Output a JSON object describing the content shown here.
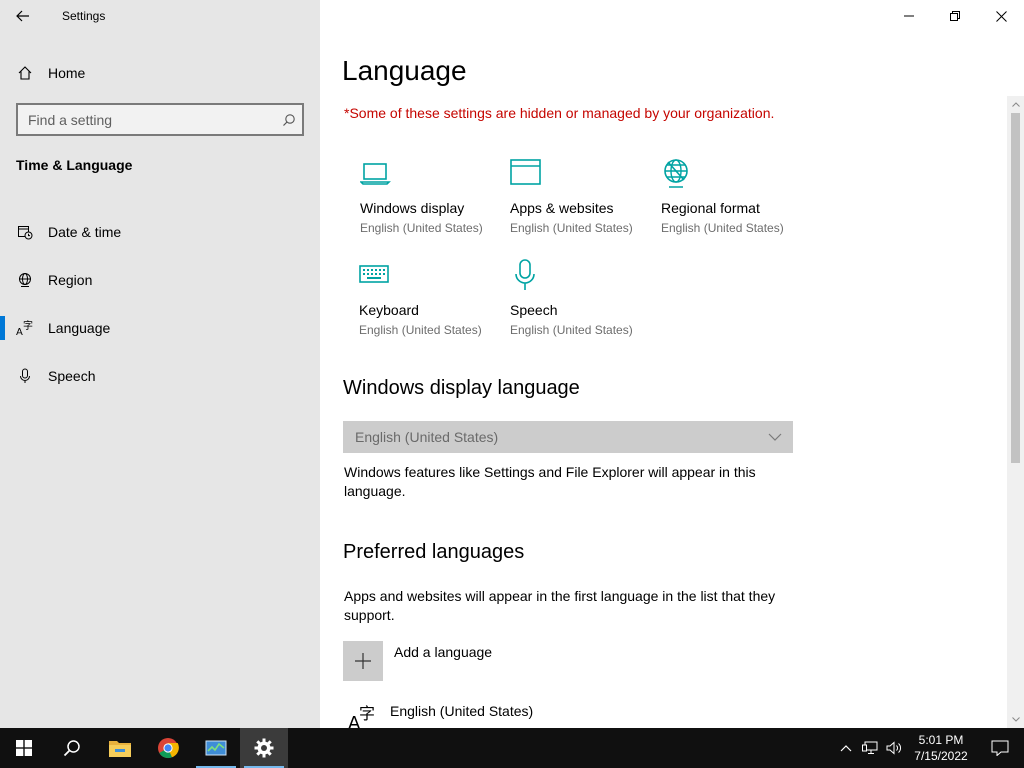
{
  "window": {
    "title": "Settings"
  },
  "sidebar": {
    "home_label": "Home",
    "search_placeholder": "Find a setting",
    "section_title": "Time & Language",
    "items": [
      {
        "label": "Date & time",
        "icon": "calendar-clock-icon",
        "active": false
      },
      {
        "label": "Region",
        "icon": "globe-icon",
        "active": false
      },
      {
        "label": "Language",
        "icon": "language-icon",
        "active": true
      },
      {
        "label": "Speech",
        "icon": "microphone-icon",
        "active": false
      }
    ]
  },
  "main": {
    "title": "Language",
    "org_notice": "*Some of these settings are hidden or managed by your organization.",
    "tiles": [
      {
        "name": "Windows display",
        "sub": "English (United States)",
        "icon": "laptop-icon"
      },
      {
        "name": "Apps & websites",
        "sub": "English (United States)",
        "icon": "browser-window-icon"
      },
      {
        "name": "Regional format",
        "sub": "English (United States)",
        "icon": "globe-icon"
      },
      {
        "name": "Keyboard",
        "sub": "English (United States)",
        "icon": "keyboard-icon"
      },
      {
        "name": "Speech",
        "sub": "English (United States)",
        "icon": "microphone-icon"
      }
    ],
    "display_language": {
      "heading": "Windows display language",
      "selected": "English (United States)",
      "description": "Windows features like Settings and File Explorer will appear in this language."
    },
    "preferred": {
      "heading": "Preferred languages",
      "description": "Apps and websites will appear in the first language in the list that they support.",
      "add_label": "Add a language",
      "languages": [
        "English (United States)"
      ]
    }
  },
  "taskbar": {
    "time": "5:01 PM",
    "date": "7/15/2022",
    "apps": [
      "start-icon",
      "search-icon",
      "file-explorer-icon",
      "chrome-icon",
      "task-manager-icon",
      "settings-icon"
    ]
  },
  "colors": {
    "accent": "#0078d7",
    "icon_teal": "#00a3a3",
    "warning_red": "#c50500",
    "sidebar_bg": "#e6e6e6",
    "taskbar_bg": "#101010"
  }
}
